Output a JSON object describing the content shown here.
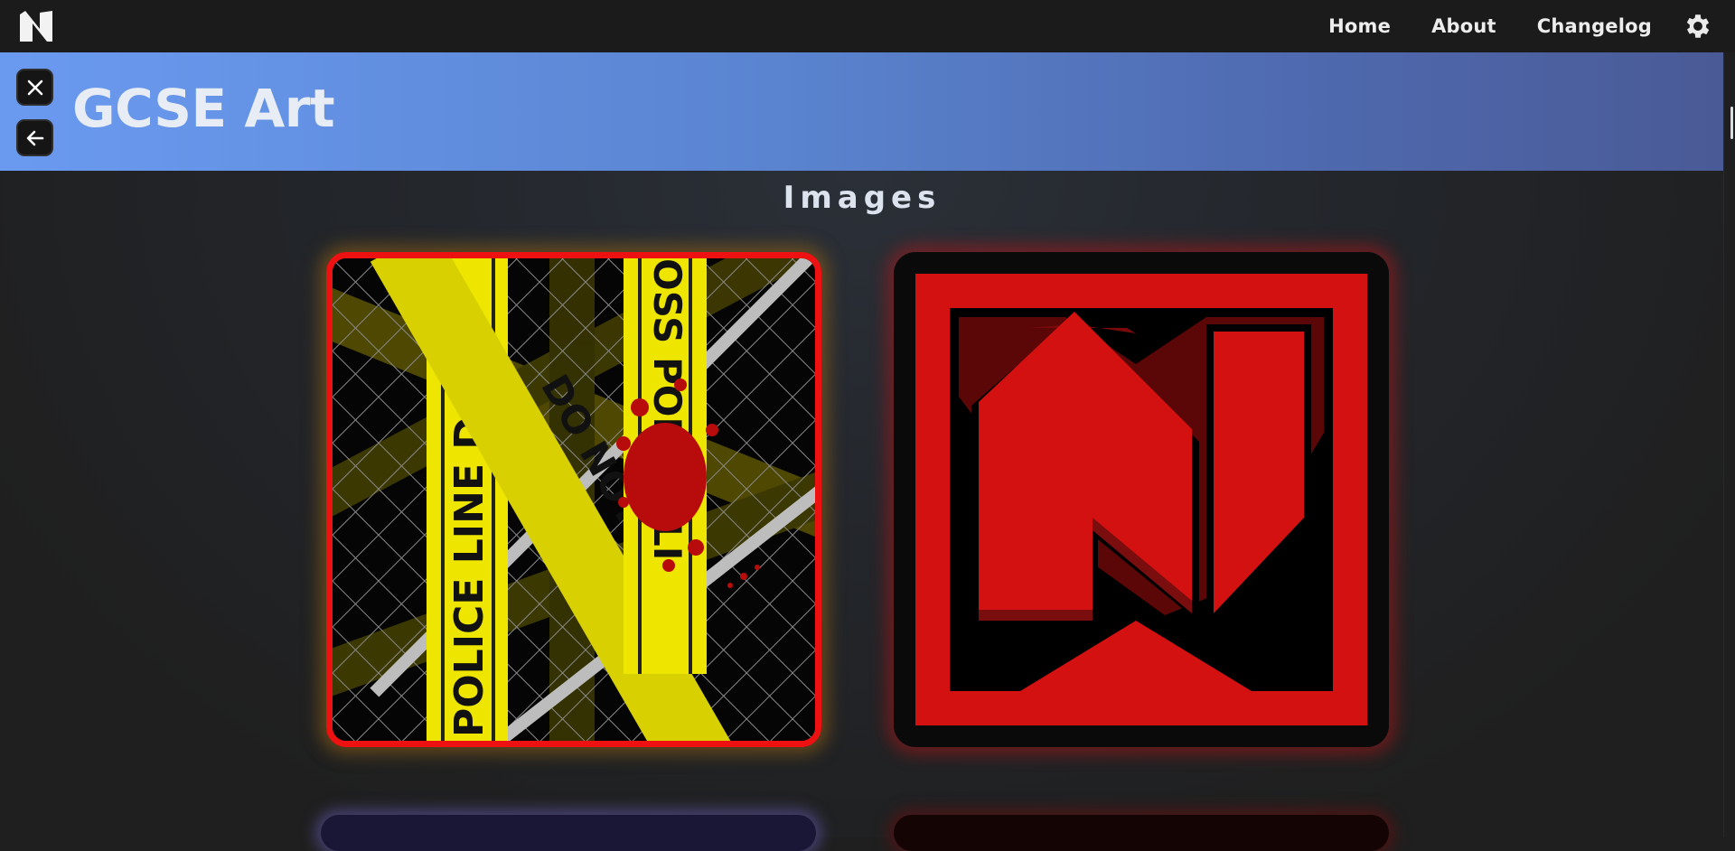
{
  "navbar": {
    "logo_icon": "n-logo-icon",
    "links": [
      "Home",
      "About",
      "Changelog"
    ],
    "settings_icon": "gear-icon"
  },
  "header": {
    "title": "GCSE Art",
    "close_icon": "close-icon",
    "back_icon": "arrow-left-icon",
    "gradient": [
      "#6a9af0",
      "#4a5a96"
    ]
  },
  "section": {
    "title": "Images"
  },
  "gallery": {
    "cards": [
      {
        "name": "police-line-artwork",
        "text": [
          "POLICE LINE DO",
          "DO NOT C",
          "OSS POLICE LI"
        ]
      },
      {
        "name": "red-n-logo-artwork"
      }
    ]
  },
  "colors": {
    "accent_red": "#d41111",
    "tape_yellow": "#f2e600",
    "navbar": "#1b1b1b"
  }
}
